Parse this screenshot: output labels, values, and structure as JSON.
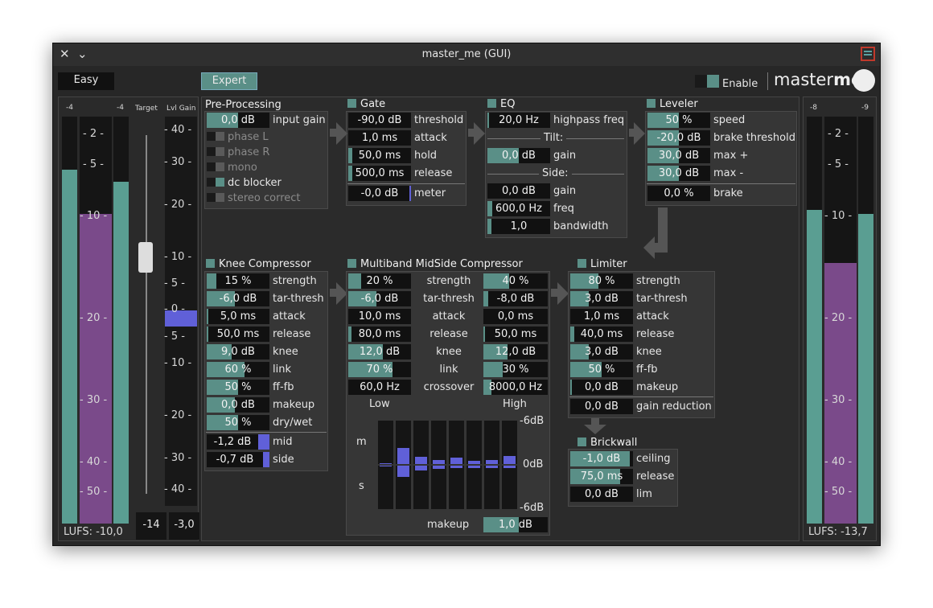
{
  "window": {
    "title": "master_me (GUI)"
  },
  "top": {
    "easy": "Easy",
    "expert": "Expert",
    "enable": "Enable",
    "logo_a": "master",
    "logo_b": "me"
  },
  "in_meter": {
    "peak_l": "-4",
    "peak_r": "-4",
    "target": "Target",
    "lvlgain": "Lvl Gain",
    "lufs": "LUFS: -10,0",
    "target_value": "-14",
    "gain_value": "-3,0",
    "scale": [
      "- 2 -",
      "- 5 -",
      "- 10 -",
      "- 20 -",
      "- 30 -",
      "- 40 -",
      "- 50 -"
    ],
    "gain_scale": [
      "- 40 -",
      "- 30 -",
      "- 20 -",
      "- 10 -",
      "- 5 -",
      "- 0 -",
      "- 5 -",
      "- 10 -",
      "- 20 -",
      "- 30 -",
      "- 40 -"
    ],
    "level_l": 0.87,
    "level_r": 0.84,
    "loudness": 0.76
  },
  "out_meter": {
    "peak_l": "-8",
    "peak_r": "-9",
    "lufs": "LUFS: -13,7",
    "scale": [
      "- 2 -",
      "- 5 -",
      "- 10 -",
      "- 20 -",
      "- 30 -",
      "- 40 -",
      "- 50 -"
    ],
    "level_l": 0.77,
    "level_r": 0.76,
    "loudness": 0.64
  },
  "pre": {
    "title": "Pre-Processing",
    "input_gain": "0,0 dB",
    "input_gain_label": "input gain",
    "phase_l": "phase L",
    "phase_r": "phase R",
    "mono": "mono",
    "dc_blocker": "dc blocker",
    "stereo_correct": "stereo correct"
  },
  "gate": {
    "title": "Gate",
    "threshold": "-90,0 dB",
    "threshold_label": "threshold",
    "attack": "1,0 ms",
    "attack_label": "attack",
    "hold": "50,0 ms",
    "hold_label": "hold",
    "release": "500,0 ms",
    "release_label": "release",
    "meter": "-0,0 dB",
    "meter_label": "meter"
  },
  "eq": {
    "title": "EQ",
    "hp": "20,0 Hz",
    "hp_label": "highpass freq",
    "tilt": "Tilt:",
    "tilt_gain": "0,0 dB",
    "gain_label": "gain",
    "side": "Side:",
    "side_gain": "0,0 dB",
    "freq": "600,0 Hz",
    "freq_label": "freq",
    "bw": "1,0",
    "bw_label": "bandwidth"
  },
  "leveler": {
    "title": "Leveler",
    "speed": "50 %",
    "speed_label": "speed",
    "brake_thr": "-20,0 dB",
    "brake_thr_label": "brake threshold",
    "max_plus": "30,0 dB",
    "max_plus_label": "max +",
    "max_minus": "30,0 dB",
    "max_minus_label": "max -",
    "brake": "0,0 %",
    "brake_label": "brake"
  },
  "knee": {
    "title": "Knee Compressor",
    "rows": [
      [
        "15 %",
        "strength",
        0.15
      ],
      [
        "-6,0 dB",
        "tar-thresh",
        0.45
      ],
      [
        "5,0 ms",
        "attack",
        0.03
      ],
      [
        "50,0 ms",
        "release",
        0.03
      ],
      [
        "9,0 dB",
        "knee",
        0.4
      ],
      [
        "60 %",
        "link",
        0.6
      ],
      [
        "50 %",
        "ff-fb",
        0.5
      ],
      [
        "0,0 dB",
        "makeup",
        0.45
      ],
      [
        "50 %",
        "dry/wet",
        0.5
      ]
    ],
    "mid": "-1,2 dB",
    "mid_label": "mid",
    "side": "-0,7 dB",
    "side_label": "side"
  },
  "mb": {
    "title": "Multiband MidSide Compressor",
    "labels": [
      "strength",
      "tar-thresh",
      "attack",
      "release",
      "knee",
      "link",
      "crossover"
    ],
    "low": [
      [
        "20 %",
        0.2
      ],
      [
        "-6,0 dB",
        0.45
      ],
      [
        "10,0 ms",
        0.0
      ],
      [
        "80,0 ms",
        0.05
      ],
      [
        "12,0 dB",
        0.55
      ],
      [
        "70 %",
        0.7
      ],
      [
        "60,0 Hz",
        0.0
      ]
    ],
    "high": [
      [
        "40 %",
        0.4
      ],
      [
        "-8,0 dB",
        0.08
      ],
      [
        "0,0 ms",
        0.0
      ],
      [
        "50,0 ms",
        0.03
      ],
      [
        "12,0 dB",
        0.38
      ],
      [
        "30 %",
        0.3
      ],
      [
        "8000,0 Hz",
        0.12
      ]
    ],
    "low_label": "Low",
    "high_label": "High",
    "m": "m",
    "s": "s",
    "top_db": "-6dB",
    "mid_db": "0dB",
    "bot_db": "-6dB",
    "makeup": "1,0 dB",
    "makeup_label": "makeup",
    "bands": [
      [
        0.02,
        0.02
      ],
      [
        0.36,
        0.25
      ],
      [
        0.16,
        0.1
      ],
      [
        0.09,
        0.08
      ],
      [
        0.14,
        0.06
      ],
      [
        0.07,
        0.05
      ],
      [
        0.09,
        0.06
      ],
      [
        0.18,
        0.05
      ]
    ]
  },
  "limiter": {
    "title": "Limiter",
    "rows": [
      [
        "80 %",
        "strength",
        0.45
      ],
      [
        "3,0 dB",
        "tar-thresh",
        0.3
      ],
      [
        "1,0 ms",
        "attack",
        0.0
      ],
      [
        "40,0 ms",
        "release",
        0.06
      ],
      [
        "3,0 dB",
        "knee",
        0.3
      ],
      [
        "50 %",
        "ff-fb",
        0.5
      ],
      [
        "0,0 dB",
        "makeup",
        0.03
      ]
    ],
    "gr": "0,0 dB",
    "gr_label": "gain reduction"
  },
  "brickwall": {
    "title": "Brickwall",
    "ceiling": "-1,0 dB",
    "ceiling_label": "ceiling",
    "release": "75,0 ms",
    "release_label": "release",
    "lim": "0,0 dB",
    "lim_label": "lim"
  }
}
